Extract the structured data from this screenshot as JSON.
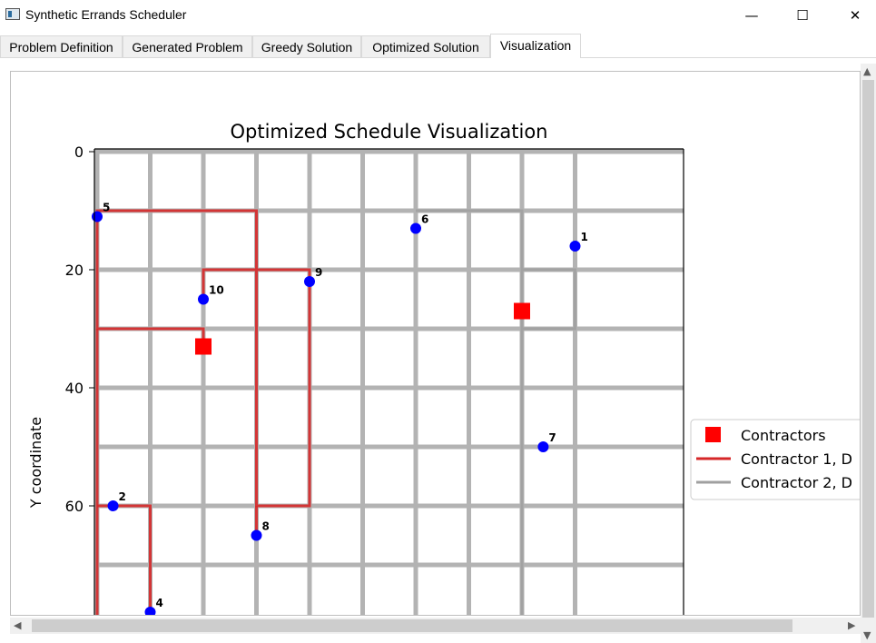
{
  "window": {
    "title": "Synthetic Errands Scheduler",
    "minimize": "—",
    "maximize": "☐",
    "close": "✕"
  },
  "tabs": [
    {
      "label": "Problem Definition"
    },
    {
      "label": "Generated Problem"
    },
    {
      "label": "Greedy Solution"
    },
    {
      "label": "Optimized Solution"
    },
    {
      "label": "Visualization",
      "active": true
    }
  ],
  "chart_data": {
    "type": "scatter",
    "title": "Optimized Schedule Visualization",
    "ylabel": "Y coordinate",
    "xlabel": "",
    "y_inverted": true,
    "xlim": [
      0,
      100
    ],
    "ylim": [
      0,
      80
    ],
    "y_ticks": [
      0,
      20,
      40,
      60
    ],
    "errands": [
      {
        "id": "1",
        "x": 90,
        "y": 16
      },
      {
        "id": "2",
        "x": 3,
        "y": 60
      },
      {
        "id": "4",
        "x": 10,
        "y": 78
      },
      {
        "id": "5",
        "x": 0,
        "y": 11
      },
      {
        "id": "6",
        "x": 60,
        "y": 13
      },
      {
        "id": "7",
        "x": 84,
        "y": 50
      },
      {
        "id": "8",
        "x": 30,
        "y": 65
      },
      {
        "id": "9",
        "x": 40,
        "y": 22
      },
      {
        "id": "10",
        "x": 20,
        "y": 25
      }
    ],
    "contractors": [
      {
        "x": 20,
        "y": 33
      },
      {
        "x": 80,
        "y": 27
      }
    ],
    "routes": [
      {
        "name": "Contractor 1, D",
        "color": "#d62728",
        "points": [
          [
            20,
            33
          ],
          [
            20,
            30
          ],
          [
            0,
            30
          ],
          [
            0,
            10
          ],
          [
            30,
            10
          ],
          [
            30,
            60
          ],
          [
            40,
            60
          ],
          [
            40,
            20
          ],
          [
            20,
            20
          ],
          [
            20,
            25
          ]
        ]
      },
      {
        "name": "Contractor 1, D",
        "color": "#d62728",
        "points": [
          [
            0,
            30
          ],
          [
            0,
            80
          ]
        ]
      },
      {
        "name": "Contractor 1, D",
        "color": "#d62728",
        "points": [
          [
            0,
            60
          ],
          [
            10,
            60
          ],
          [
            10,
            80
          ]
        ]
      },
      {
        "name": "Contractor 1, D",
        "color": "#d62728",
        "points": [
          [
            30,
            60
          ],
          [
            30,
            65
          ]
        ]
      },
      {
        "name": "Contractor 2, D",
        "color": "#a0a0a0",
        "points": [
          [
            60,
            10
          ],
          [
            80,
            10
          ],
          [
            80,
            30
          ],
          [
            90,
            30
          ],
          [
            90,
            20
          ],
          [
            80,
            20
          ],
          [
            80,
            80
          ]
        ]
      }
    ],
    "legend": {
      "placement": "right",
      "entries": [
        "Contractors",
        "Contractor 1, D",
        "Contractor 2, D"
      ]
    },
    "colors": {
      "errand": "#0000ff",
      "contractor": "#ff0000",
      "route1": "#d62728",
      "route2": "#a0a0a0",
      "grid": "#b3b3b3"
    }
  }
}
